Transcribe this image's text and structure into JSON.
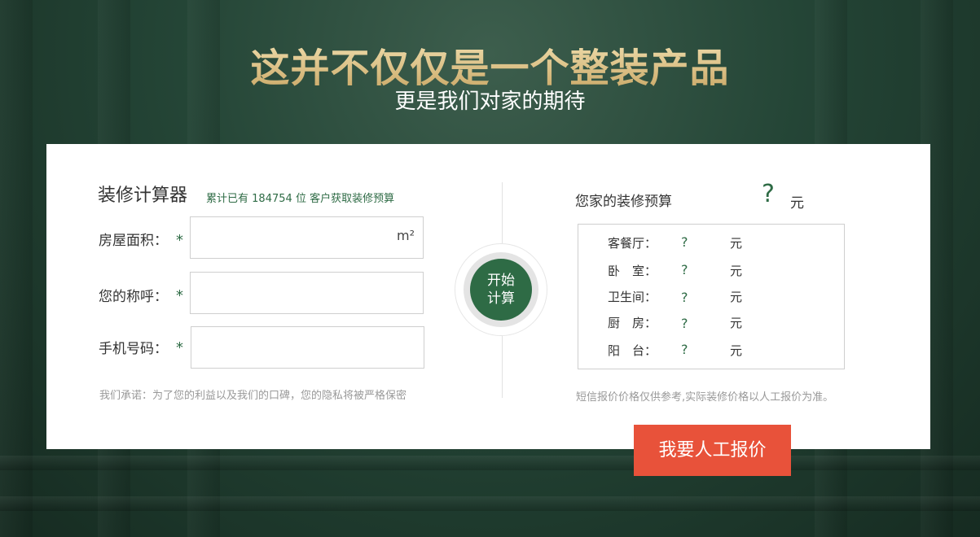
{
  "hero": {
    "title": "这并不仅仅是一个整装产品",
    "subtitle": "更是我们对家的期待"
  },
  "calculator": {
    "title": "装修计算器",
    "counter_prefix": "累计已有",
    "counter_value": "184754",
    "counter_suffix": "位 客户获取装修预算",
    "fields": [
      {
        "label": "房屋面积：",
        "required_mark": "*",
        "unit": "m²",
        "value": ""
      },
      {
        "label": "您的称呼：",
        "required_mark": "*",
        "value": ""
      },
      {
        "label": "手机号码：",
        "required_mark": "*",
        "value": ""
      }
    ],
    "promise": "我们承诺：为了您的利益以及我们的口碑，您的隐私将被严格保密",
    "start_button": {
      "line1": "开始",
      "line2": "计算"
    }
  },
  "result": {
    "title": "您家的装修预算",
    "total_value": "?",
    "currency": "元",
    "items": [
      {
        "label": "客餐厅：",
        "value": "?",
        "currency": "元"
      },
      {
        "label": "卧　室：",
        "value": "?",
        "currency": "元"
      },
      {
        "label": "卫生间：",
        "value": "?",
        "currency": "元"
      },
      {
        "label": "厨　房：",
        "value": "?",
        "currency": "元"
      },
      {
        "label": "阳　台：",
        "value": "?",
        "currency": "元"
      }
    ],
    "disclaimer": "短信报价价格仅供参考,实际装修价格以人工报价为准。",
    "quote_button": "我要人工报价"
  },
  "colors": {
    "accent_green": "#2e6b45",
    "button_orange": "#e8523a",
    "title_gold": "#d9c08a"
  }
}
